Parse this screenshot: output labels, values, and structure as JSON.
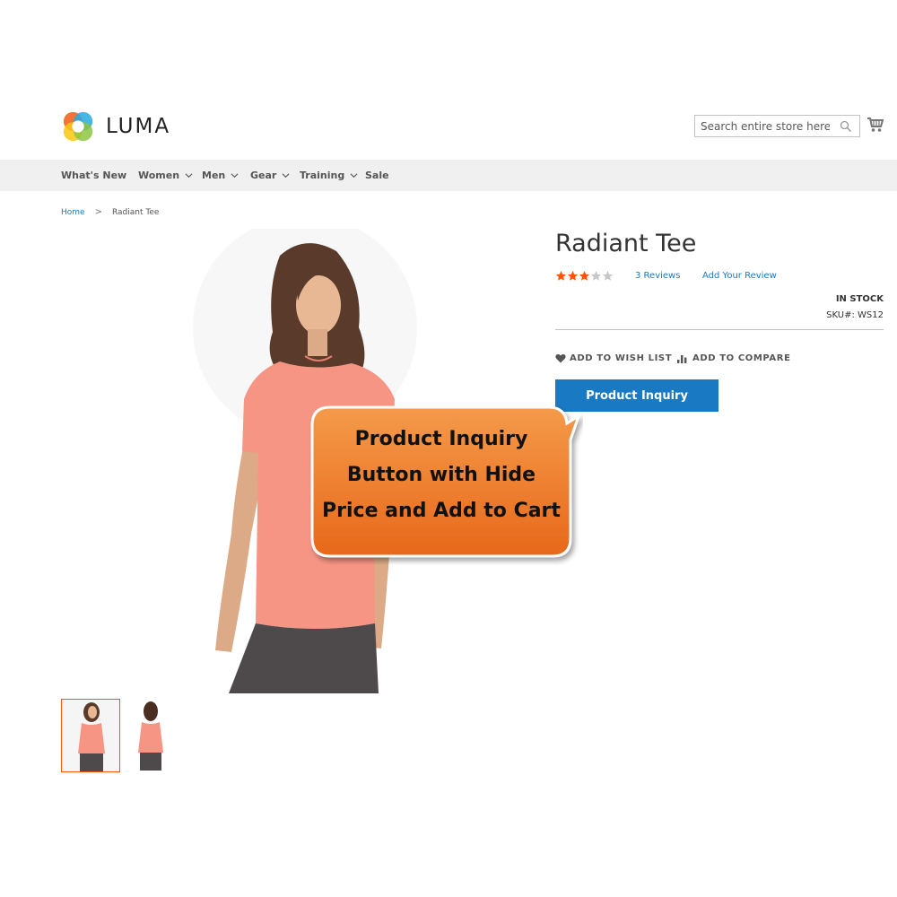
{
  "header": {
    "brand_name": "LUMA",
    "search_placeholder": "Search entire store here...",
    "icons": [
      "luma-logo",
      "search-icon",
      "cart-icon"
    ]
  },
  "nav": {
    "items": [
      {
        "label": "What's New",
        "has_dropdown": false
      },
      {
        "label": "Women",
        "has_dropdown": true
      },
      {
        "label": "Men",
        "has_dropdown": true
      },
      {
        "label": "Gear",
        "has_dropdown": true
      },
      {
        "label": "Training",
        "has_dropdown": true
      },
      {
        "label": "Sale",
        "has_dropdown": false
      }
    ]
  },
  "breadcrumb": {
    "home": "Home",
    "separator": ">",
    "current": "Radiant Tee"
  },
  "product": {
    "title": "Radiant Tee",
    "rating_stars": 3,
    "rating_max": 5,
    "reviews_label": "3  Reviews",
    "add_review_label": "Add Your Review",
    "stock_label": "IN STOCK",
    "sku_label": "SKU#:  WS12",
    "wishlist_label": "ADD TO WISH LIST",
    "compare_label": "ADD TO COMPARE",
    "inquiry_button_label": "Product Inquiry"
  },
  "callout": {
    "line1": "Product Inquiry",
    "line2": "Button with Hide",
    "line3": "Price and Add to Cart"
  },
  "colors": {
    "link": "#1979c3",
    "button": "#1979c3",
    "star_filled": "#ff5501",
    "star_empty": "#c7c7c7",
    "callout_orange": "#f07a22",
    "nav_bg": "#f0f0f0"
  }
}
